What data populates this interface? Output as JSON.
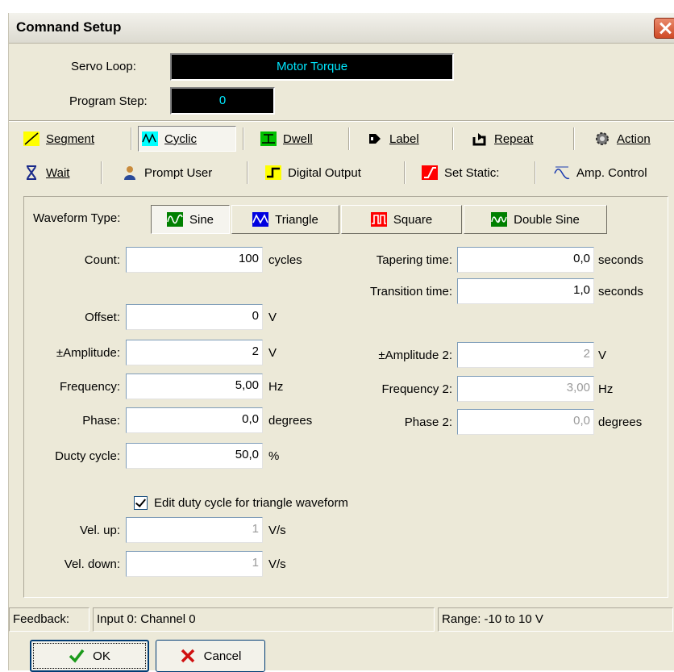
{
  "window": {
    "title": "Comnand Setup"
  },
  "header": {
    "servo_loop_label": "Servo Loop:",
    "servo_loop_value": "Motor Torque",
    "program_step_label": "Program Step:",
    "program_step_value": "0"
  },
  "toolbar": {
    "row1": [
      {
        "label": "Segment",
        "icon": "segment-icon",
        "pressed": false
      },
      {
        "label": "Cyclic",
        "icon": "cyclic-icon",
        "pressed": true
      },
      {
        "label": "Dwell",
        "icon": "dwell-icon",
        "pressed": false
      },
      {
        "label": "Label",
        "icon": "label-icon",
        "pressed": false
      },
      {
        "label": "Repeat",
        "icon": "repeat-icon",
        "pressed": false
      },
      {
        "label": "Action",
        "icon": "action-gear-icon",
        "pressed": false
      }
    ],
    "row2": [
      {
        "label": "Wait",
        "icon": "hourglass-icon"
      },
      {
        "label": "Prompt User",
        "icon": "user-icon"
      },
      {
        "label": "Digital Output",
        "icon": "digital-output-icon"
      },
      {
        "label": "Set Static:",
        "icon": "set-static-icon"
      },
      {
        "label": "Amp. Control",
        "icon": "amp-control-icon"
      }
    ]
  },
  "waveform": {
    "label": "Waveform Type:",
    "types": [
      {
        "label": "Sine",
        "icon": "sine-wave-icon",
        "selected": true
      },
      {
        "label": "Triangle",
        "icon": "triangle-wave-icon",
        "selected": false
      },
      {
        "label": "Square",
        "icon": "square-wave-icon",
        "selected": false
      },
      {
        "label": "Double Sine",
        "icon": "double-sine-wave-icon",
        "selected": false
      }
    ]
  },
  "params": {
    "count": {
      "label": "Count:",
      "value": "100",
      "unit": "cycles"
    },
    "tapering": {
      "label": "Tapering time:",
      "value": "0,0",
      "unit": "seconds"
    },
    "transition": {
      "label": "Transition time:",
      "value": "1,0",
      "unit": "seconds"
    },
    "offset": {
      "label": "Offset:",
      "value": "0",
      "unit": "V"
    },
    "amplitude": {
      "label": "±Amplitude:",
      "value": "2",
      "unit": "V"
    },
    "amplitude2": {
      "label": "±Amplitude 2:",
      "value": "2",
      "unit": "V"
    },
    "frequency": {
      "label": "Frequency:",
      "value": "5,00",
      "unit": "Hz"
    },
    "frequency2": {
      "label": "Frequency 2:",
      "value": "3,00",
      "unit": "Hz"
    },
    "phase": {
      "label": "Phase:",
      "value": "0,0",
      "unit": "degrees"
    },
    "phase2": {
      "label": "Phase 2:",
      "value": "0,0",
      "unit": "degrees"
    },
    "duty": {
      "label": "Ducty cycle:",
      "value": "50,0",
      "unit": "%"
    },
    "edit_duty": {
      "label": "Edit duty cycle for triangle waveform",
      "checked": true
    },
    "vel_up": {
      "label": "Vel. up:",
      "value": "1",
      "unit": "V/s"
    },
    "vel_down": {
      "label": "Vel. down:",
      "value": "1",
      "unit": "V/s"
    }
  },
  "status": {
    "feedback_label": "Feedback:",
    "feedback_value": "Input 0: Channel 0",
    "range": "Range: -10 to 10 V"
  },
  "buttons": {
    "ok": "OK",
    "cancel": "Cancel"
  },
  "colors": {
    "readout_bg": "#000000",
    "readout_text": "#00e8ff",
    "dialog_bg": "#ece9d8"
  }
}
